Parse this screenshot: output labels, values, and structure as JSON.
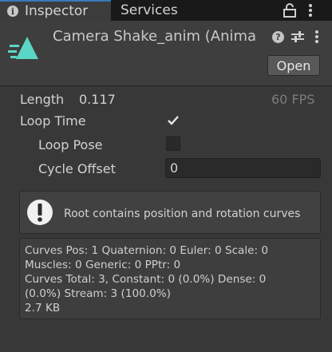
{
  "tabs": {
    "inspector": "Inspector",
    "services": "Services"
  },
  "header": {
    "title": "Camera Shake_anim (Anima",
    "open_button": "Open",
    "help_icon": "question-circle-icon",
    "icon": "animation-clip-icon"
  },
  "properties": {
    "length_label": "Length",
    "length_value": "0.117",
    "fps_value": "60 FPS",
    "loop_time_label": "Loop Time",
    "loop_time_checked": true,
    "loop_pose_label": "Loop Pose",
    "loop_pose_checked": false,
    "cycle_offset_label": "Cycle Offset",
    "cycle_offset_value": "0"
  },
  "helpbox": {
    "icon": "warning-icon",
    "message": "Root contains position and rotation curves"
  },
  "info": {
    "line1": "Curves Pos: 1 Quaternion: 0 Euler: 0 Scale: 0",
    "line2": "Muscles: 0 Generic: 0 PPtr: 0",
    "line3": "Curves Total: 3, Constant: 0 (0.0%) Dense: 0",
    "line4": "(0.0%) Stream: 3 (100.0%)",
    "line5": "2.7 KB"
  },
  "colors": {
    "accent_icon": "#5ad6c6",
    "tab_highlight": "#3a79bb",
    "background": "#383838"
  }
}
